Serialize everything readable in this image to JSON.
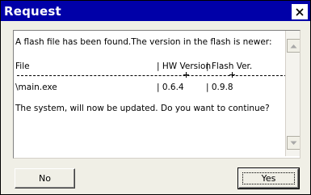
{
  "window": {
    "title": "Request",
    "close_icon": "close-icon"
  },
  "message": {
    "line1": "A flash file has been found.The version in the flash is newer:",
    "columns": {
      "file": "File",
      "hw": "| HW Version",
      "flash": "| Flash Ver."
    },
    "row": {
      "file": "\\main.exe",
      "hw": "| 0.6.4",
      "flash": "| 0.9.8"
    },
    "line5": "The system, will now be updated. Do you want to continue?"
  },
  "scrollbar": {
    "up_icon": "scroll-up-icon",
    "down_icon": "scroll-down-icon"
  },
  "buttons": {
    "no_label": "No",
    "yes_label": "Yes"
  },
  "colors": {
    "titlebar": "#0000a8",
    "window_bg": "#f0efe6",
    "message_bg": "#ffffff"
  }
}
